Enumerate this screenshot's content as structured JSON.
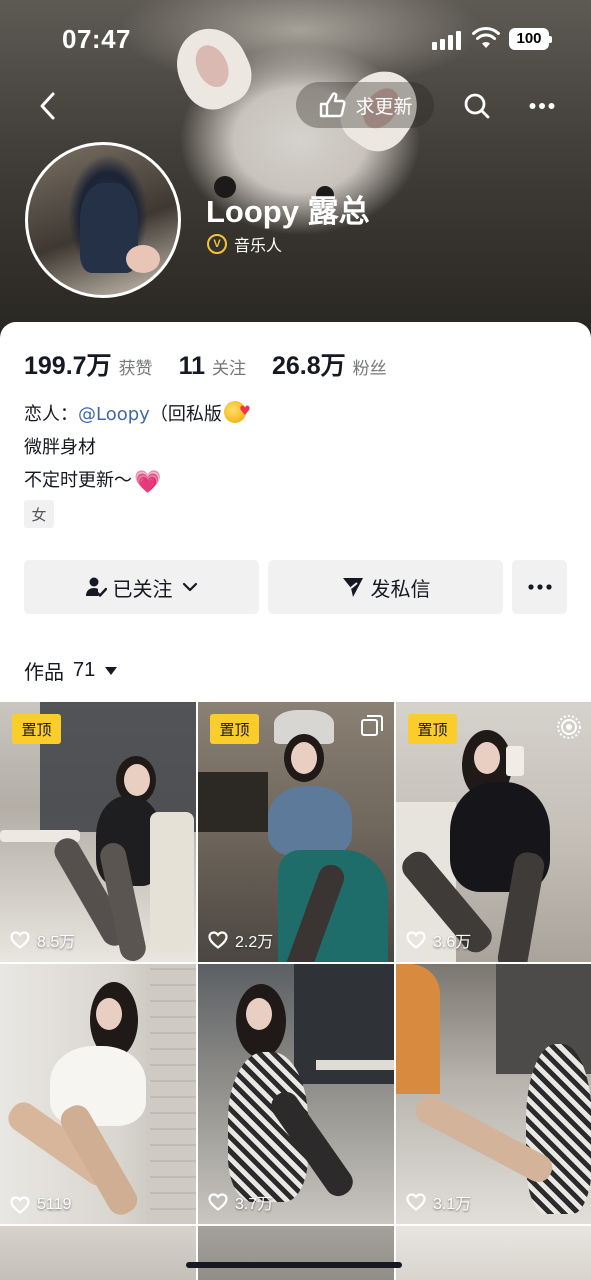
{
  "status_bar": {
    "time": "07:47",
    "battery": "100"
  },
  "top_nav": {
    "request_update_label": "求更新"
  },
  "profile": {
    "nickname": "Loopy 露总",
    "verified_label": "音乐人",
    "stats": [
      {
        "value": "199.7万",
        "label": "获赞"
      },
      {
        "value": "11",
        "label": "关注"
      },
      {
        "value": "26.8万",
        "label": "粉丝"
      }
    ],
    "bio": {
      "line1_prefix": "恋人：",
      "line1_mention": "@Loopy",
      "line1_suffix": "（回私版",
      "line2": "微胖身材",
      "line3": "不定时更新～"
    },
    "tag": "女"
  },
  "actions": {
    "follow_label": "已关注",
    "message_label": "发私信"
  },
  "works": {
    "label": "作品",
    "count": "71",
    "items": [
      {
        "pinned_label": "置顶",
        "likes": "8.5万"
      },
      {
        "pinned_label": "置顶",
        "likes": "2.2万"
      },
      {
        "pinned_label": "置顶",
        "likes": "3.6万"
      },
      {
        "pinned_label": "",
        "likes": "5119"
      },
      {
        "pinned_label": "",
        "likes": "3.7万"
      },
      {
        "pinned_label": "",
        "likes": "3.1万"
      }
    ]
  },
  "colors": {
    "accent_pin": "#fbcd2c",
    "mention": "#3f6aa9",
    "verified": "#f5c33b",
    "text_primary": "#161823",
    "text_secondary": "#75777d",
    "button_bg": "#f1f1f2"
  },
  "icons": [
    "back-icon",
    "hand-pointer-icon",
    "search-icon",
    "more-icon",
    "verified-badge-icon",
    "user-check-icon",
    "chevron-down-icon",
    "send-icon",
    "heart-icon",
    "multi-image-icon",
    "live-icon"
  ]
}
